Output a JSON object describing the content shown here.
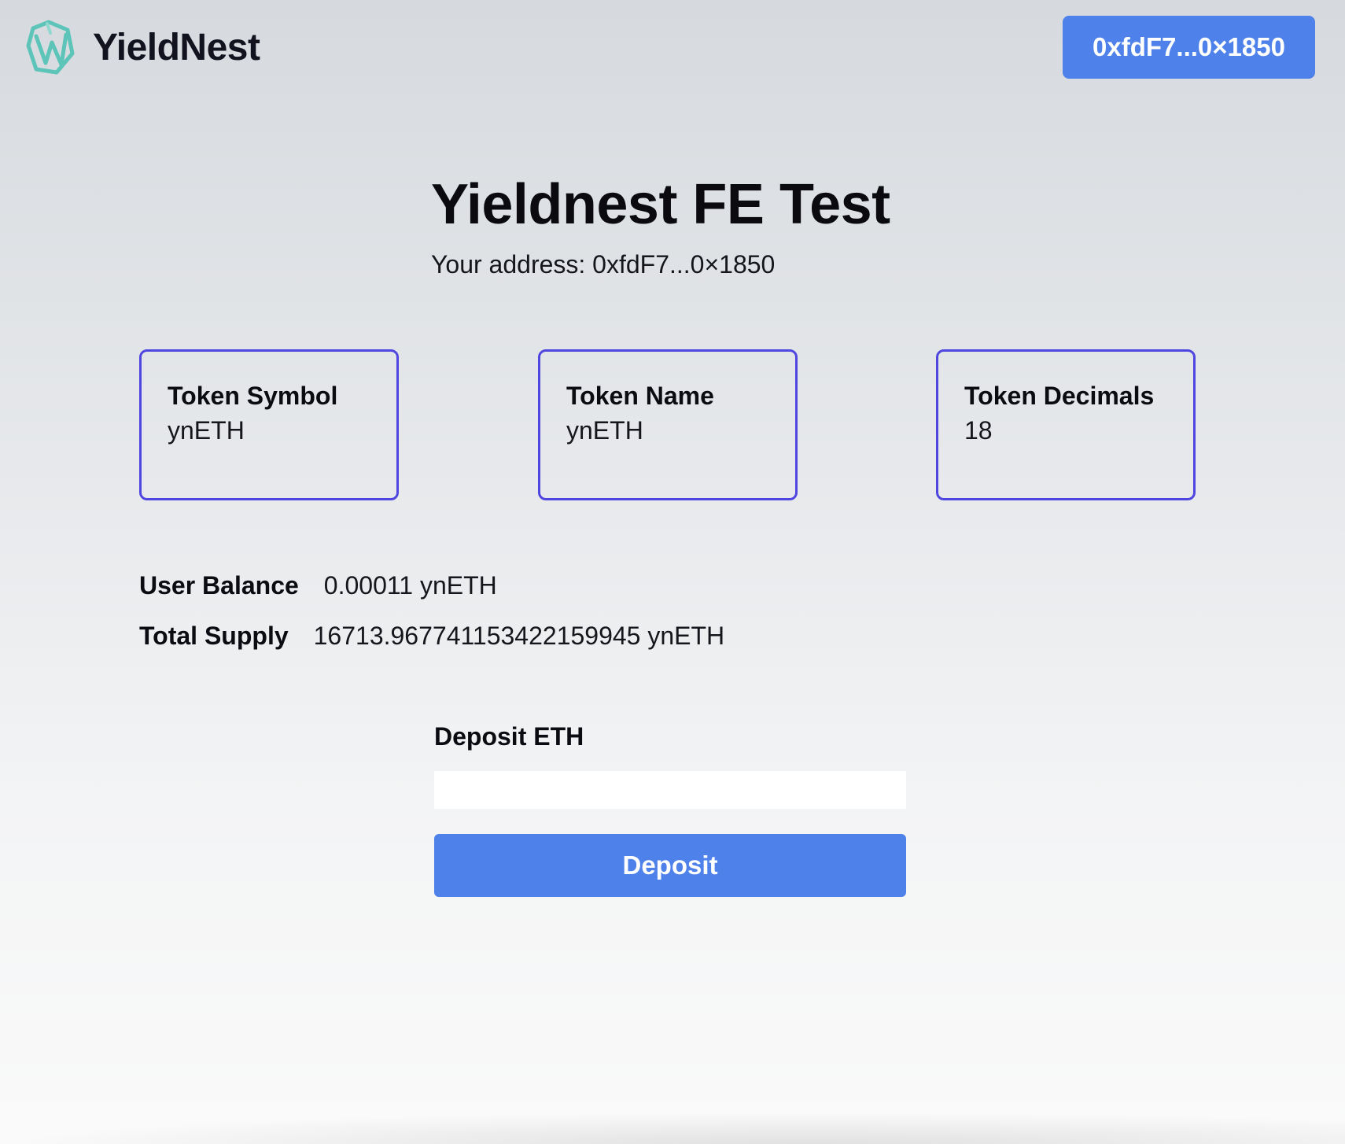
{
  "header": {
    "brand_name": "YieldNest",
    "logo_icon": "yieldnest-logo-icon",
    "wallet_button_label": "0xfdF7...0×1850"
  },
  "main": {
    "title": "Yieldnest FE Test",
    "address_line": "Your address: 0xfdF7...0×1850"
  },
  "cards": [
    {
      "label": "Token Symbol",
      "value": "ynETH"
    },
    {
      "label": "Token Name",
      "value": "ynETH"
    },
    {
      "label": "Token Decimals",
      "value": "18"
    }
  ],
  "stats": {
    "balance_label": "User Balance",
    "balance_value": "0.00011 ynETH",
    "supply_label": "Total Supply",
    "supply_value": "16713.967741153422159945 ynETH"
  },
  "deposit": {
    "label": "Deposit ETH",
    "input_value": "",
    "button_label": "Deposit"
  },
  "colors": {
    "accent_button": "#4f81eb",
    "card_border": "#4f46e0",
    "logo_teal": "#5cc4b8"
  }
}
